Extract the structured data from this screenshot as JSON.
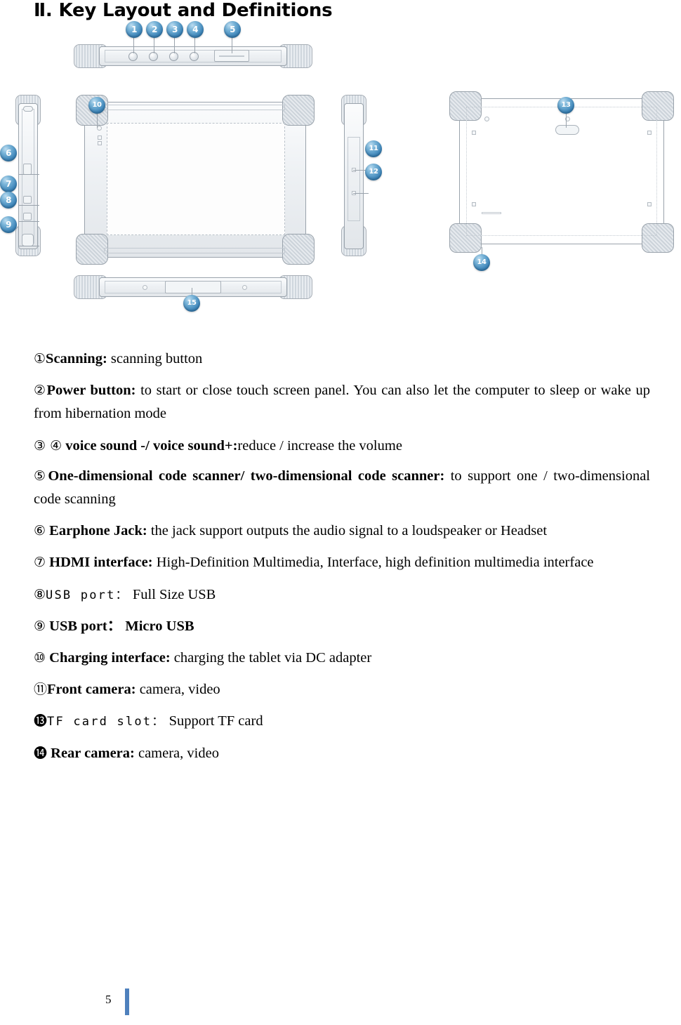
{
  "page": {
    "heading": "Ⅱ. Key Layout and Definitions",
    "page_number": "5",
    "accent_color": "#4f81bd",
    "callout_color": "#3f87bb"
  },
  "figure": {
    "name": "rugged-tablet-key-layout",
    "views": [
      {
        "name": "top-edge-view",
        "callouts": [
          "1",
          "2",
          "3",
          "4",
          "5"
        ]
      },
      {
        "name": "left-edge-view",
        "callouts": [
          "6",
          "7",
          "8",
          "9"
        ]
      },
      {
        "name": "front-view",
        "callouts": [
          "11"
        ]
      },
      {
        "name": "right-edge-view",
        "callouts": [
          "11",
          "12"
        ]
      },
      {
        "name": "rear-view",
        "callouts": [
          "13",
          "14"
        ]
      },
      {
        "name": "bottom-edge-view",
        "callouts": [
          "15"
        ]
      }
    ],
    "callouts": [
      {
        "id": "c1",
        "label": "1",
        "view": "top-edge-view"
      },
      {
        "id": "c2",
        "label": "2",
        "view": "top-edge-view"
      },
      {
        "id": "c3",
        "label": "3",
        "view": "top-edge-view"
      },
      {
        "id": "c4",
        "label": "4",
        "view": "top-edge-view"
      },
      {
        "id": "c5",
        "label": "5",
        "view": "top-edge-view"
      },
      {
        "id": "c6",
        "label": "6",
        "view": "left-edge-view"
      },
      {
        "id": "c7",
        "label": "7",
        "view": "left-edge-view"
      },
      {
        "id": "c8",
        "label": "8",
        "view": "left-edge-view"
      },
      {
        "id": "c9",
        "label": "9",
        "view": "left-edge-view"
      },
      {
        "id": "c10",
        "label": "10",
        "view": "front-view"
      },
      {
        "id": "c11",
        "label": "11",
        "view": "right-edge-view"
      },
      {
        "id": "c12",
        "label": "12",
        "view": "right-edge-view"
      },
      {
        "id": "c13",
        "label": "13",
        "view": "rear-view"
      },
      {
        "id": "c14",
        "label": "14",
        "view": "rear-view"
      },
      {
        "id": "c15",
        "label": "15",
        "view": "bottom-edge-view"
      }
    ]
  },
  "definitions": [
    {
      "number": "①",
      "term": "Scanning:",
      "desc": " scanning button",
      "term_style": "bold",
      "desc_style": "normal"
    },
    {
      "number": "②",
      "term": "Power button:",
      "desc": " to start or close touch screen panel. You can also let the computer to sleep or wake up from hibernation mode",
      "term_style": "bold",
      "desc_style": "normal"
    },
    {
      "number": "③ ④",
      "term": "voice sound -/ voice sound+:",
      "desc": "reduce / increase the volume",
      "term_style": "bold",
      "desc_style": "normal"
    },
    {
      "number": "⑤",
      "term": "One-dimensional code scanner/ two-dimensional code scanner:",
      "desc": " to support one / two-dimensional code scanning",
      "term_style": "bold",
      "desc_style": "normal"
    },
    {
      "number": "⑥",
      "term": " Earphone Jack:",
      "desc": " the jack support outputs the audio signal to a loudspeaker or Headset",
      "term_style": "bold",
      "desc_style": "normal"
    },
    {
      "number": "⑦",
      "term": " HDMI  interface:",
      "desc": " High-Definition  Multimedia,  Interface,  high  definition multimedia interface",
      "term_style": "bold",
      "desc_style": "normal"
    },
    {
      "number": "⑧",
      "term": "USB port：",
      "desc": " Full Size USB",
      "term_style": "mono",
      "desc_style": "normal"
    },
    {
      "number": "⑨",
      "term": " USB port：",
      "desc": "  Micro USB",
      "term_style": "bold",
      "desc_style": "bold"
    },
    {
      "number": "⑩",
      "term": "  Charging interface:",
      "desc": " charging the tablet via DC adapter",
      "term_style": "bold",
      "desc_style": "normal"
    },
    {
      "number": "⑪",
      "term": "Front camera:",
      "desc": " camera, video",
      "term_style": "bold",
      "desc_style": "normal"
    },
    {
      "number": "⓭",
      "term": "TF card slot：",
      "desc": " Support TF card",
      "term_style": "mono",
      "desc_style": "normal"
    },
    {
      "number": "⓮",
      "term": " Rear camera:",
      "desc": " camera, video",
      "term_style": "bold",
      "desc_style": "normal"
    }
  ]
}
